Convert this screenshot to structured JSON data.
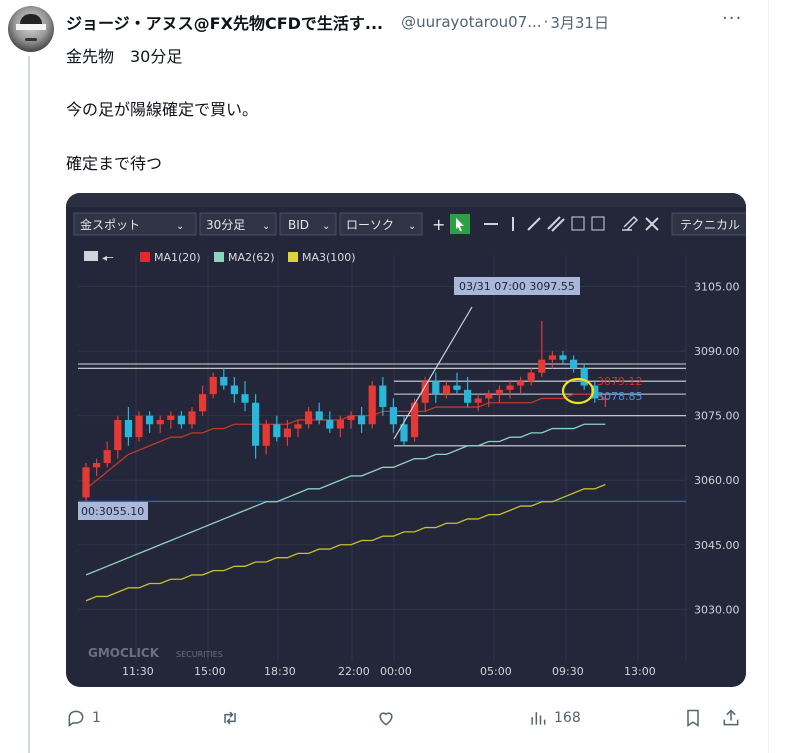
{
  "tweet": {
    "author_name": "ジョージ・アヌス@FX先物CFDで生活す...",
    "handle": "@uurayotarou07...",
    "separator": "·",
    "date": "3月31日",
    "more": "···",
    "lines": [
      "金先物　30分足",
      "今の足が陽線確定で買い。",
      "確定まで待つ"
    ]
  },
  "chart_ui": {
    "toolbar": {
      "symbol": "金スポット",
      "interval": "30分足",
      "price_type": "BID",
      "chart_type": "ローソク",
      "technical": "テクニカル"
    },
    "legend": [
      {
        "label": "MA1(20)",
        "color": "#e02b2b"
      },
      {
        "label": "MA2(62)",
        "color": "#8ed2c0"
      },
      {
        "label": "MA3(100)",
        "color": "#e0d23a"
      }
    ],
    "crosshair_tag": "03/31 07:00 3097.55",
    "left_price_tag": "00:3055.10",
    "price_labels": {
      "ma1": "3079.12",
      "price": "3078.85"
    },
    "watermark": "GMOCLICK",
    "watermark_sub": "SECURITIES"
  },
  "chart_data": {
    "type": "candlestick",
    "y_ticks": [
      "3105.00",
      "3090.00",
      "3075.00",
      "3060.00",
      "3045.00",
      "3030.00"
    ],
    "y_range": [
      3018,
      3110
    ],
    "x_ticks": [
      "11:30",
      "15:00",
      "18:30",
      "22:00",
      "00:00",
      "05:00",
      "09:30",
      "13:00"
    ],
    "candles": [
      [
        3056,
        3064,
        3054,
        3063
      ],
      [
        3063,
        3065,
        3061,
        3064
      ],
      [
        3064,
        3069,
        3063,
        3067
      ],
      [
        3067,
        3075,
        3065,
        3074
      ],
      [
        3074,
        3077,
        3068,
        3070
      ],
      [
        3070,
        3076,
        3069,
        3075
      ],
      [
        3075,
        3076,
        3071,
        3073
      ],
      [
        3073,
        3075,
        3071,
        3074
      ],
      [
        3074,
        3076,
        3072,
        3075
      ],
      [
        3075,
        3076,
        3072,
        3073
      ],
      [
        3073,
        3077,
        3072,
        3076
      ],
      [
        3076,
        3082,
        3075,
        3080
      ],
      [
        3080,
        3085,
        3079,
        3084
      ],
      [
        3084,
        3086,
        3081,
        3082
      ],
      [
        3082,
        3084,
        3078,
        3080
      ],
      [
        3080,
        3083,
        3076,
        3078
      ],
      [
        3078,
        3080,
        3065,
        3068
      ],
      [
        3068,
        3074,
        3066,
        3073
      ],
      [
        3073,
        3075,
        3069,
        3070
      ],
      [
        3070,
        3074,
        3068,
        3072
      ],
      [
        3072,
        3074,
        3070,
        3073
      ],
      [
        3073,
        3077,
        3072,
        3076
      ],
      [
        3076,
        3078,
        3073,
        3074
      ],
      [
        3074,
        3076,
        3071,
        3072
      ],
      [
        3072,
        3075,
        3070,
        3074
      ],
      [
        3074,
        3076,
        3072,
        3075
      ],
      [
        3075,
        3077,
        3071,
        3073
      ],
      [
        3073,
        3083,
        3072,
        3082
      ],
      [
        3082,
        3084,
        3075,
        3077
      ],
      [
        3077,
        3079,
        3071,
        3073
      ],
      [
        3073,
        3075,
        3068,
        3069
      ],
      [
        3070,
        3079,
        3069,
        3078
      ],
      [
        3078,
        3084,
        3076,
        3083
      ],
      [
        3083,
        3085,
        3078,
        3080
      ],
      [
        3080,
        3083,
        3079,
        3082
      ],
      [
        3082,
        3085,
        3080,
        3081
      ],
      [
        3081,
        3084,
        3077,
        3078
      ],
      [
        3078,
        3080,
        3076,
        3079
      ],
      [
        3079,
        3081,
        3077,
        3080
      ],
      [
        3080,
        3082,
        3078,
        3081
      ],
      [
        3081,
        3083,
        3079,
        3082
      ],
      [
        3082,
        3084,
        3080,
        3083
      ],
      [
        3083,
        3086,
        3082,
        3085
      ],
      [
        3085,
        3097,
        3084,
        3088
      ],
      [
        3088,
        3090,
        3086,
        3089
      ],
      [
        3089,
        3090,
        3087,
        3088
      ],
      [
        3088,
        3089,
        3085,
        3086
      ],
      [
        3086,
        3087,
        3081,
        3082
      ],
      [
        3082,
        3083,
        3078,
        3079
      ],
      [
        3079,
        3080,
        3077,
        3079
      ]
    ],
    "ma1": [
      3058,
      3060,
      3062,
      3064,
      3066,
      3067,
      3068,
      3069,
      3070,
      3070,
      3071,
      3071,
      3072,
      3072,
      3073,
      3073,
      3073,
      3073,
      3073,
      3073,
      3074,
      3074,
      3074,
      3074,
      3074,
      3075,
      3075,
      3075,
      3076,
      3076,
      3076,
      3076,
      3076,
      3077,
      3077,
      3077,
      3077,
      3077,
      3078,
      3078,
      3078,
      3078,
      3078,
      3079,
      3079,
      3079,
      3080,
      3080,
      3080,
      3079
    ],
    "ma2": [
      3038,
      3039,
      3040,
      3041,
      3042,
      3043,
      3044,
      3045,
      3046,
      3047,
      3048,
      3049,
      3050,
      3051,
      3052,
      3053,
      3054,
      3055,
      3055,
      3056,
      3057,
      3058,
      3058,
      3059,
      3060,
      3061,
      3061,
      3062,
      3063,
      3063,
      3064,
      3065,
      3065,
      3066,
      3066,
      3067,
      3068,
      3068,
      3069,
      3069,
      3070,
      3070,
      3071,
      3071,
      3072,
      3072,
      3072,
      3073,
      3073,
      3073
    ],
    "ma3": [
      3032,
      3033,
      3033,
      3034,
      3035,
      3035,
      3036,
      3036,
      3037,
      3037,
      3038,
      3038,
      3039,
      3039,
      3040,
      3040,
      3041,
      3041,
      3042,
      3042,
      3043,
      3043,
      3044,
      3044,
      3045,
      3045,
      3046,
      3046,
      3047,
      3047,
      3048,
      3048,
      3049,
      3049,
      3050,
      3050,
      3051,
      3051,
      3052,
      3052,
      3053,
      3054,
      3054,
      3055,
      3055,
      3056,
      3057,
      3058,
      3058,
      3059
    ],
    "horizontal_lines": [
      3087,
      3086,
      3083,
      3080,
      3075,
      3068,
      3055.1
    ]
  },
  "actions": {
    "reply_count": "1",
    "views_count": "168"
  }
}
